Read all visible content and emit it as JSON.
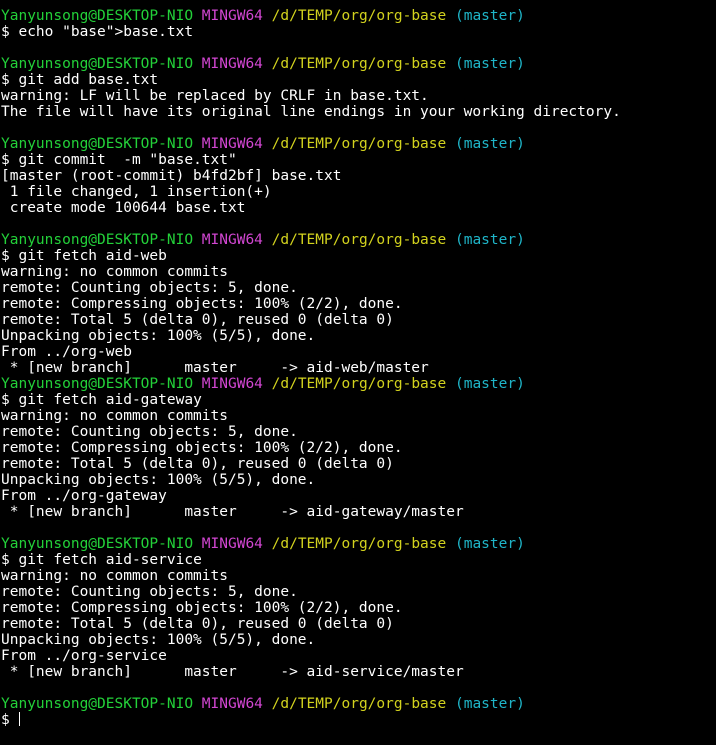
{
  "prompt": {
    "user": "Yanyunsong@DESKTOP-NIO",
    "system": "MINGW64",
    "path": "/d/TEMP/org/org-base",
    "branch": "(master)",
    "symbol": "$"
  },
  "colors": {
    "background": "#000000",
    "text": "#ffffff",
    "user": "#23d139",
    "system": "#d146d1",
    "path": "#d2d21e",
    "branch": "#1fb5c8"
  },
  "blocks": [
    {
      "command": "echo \"base\">base.txt",
      "output": []
    },
    {
      "command": "git add base.txt",
      "output": [
        "warning: LF will be replaced by CRLF in base.txt.",
        "The file will have its original line endings in your working directory."
      ]
    },
    {
      "command": "git commit  -m \"base.txt\"",
      "output": [
        "[master (root-commit) b4fd2bf] base.txt",
        " 1 file changed, 1 insertion(+)",
        " create mode 100644 base.txt"
      ]
    },
    {
      "command": "git fetch aid-web",
      "output": [
        "warning: no common commits",
        "remote: Counting objects: 5, done.",
        "remote: Compressing objects: 100% (2/2), done.",
        "remote: Total 5 (delta 0), reused 0 (delta 0)",
        "Unpacking objects: 100% (5/5), done.",
        "From ../org-web",
        " * [new branch]      master     -> aid-web/master"
      ]
    },
    {
      "command": "git fetch aid-gateway",
      "output": [
        "warning: no common commits",
        "remote: Counting objects: 5, done.",
        "remote: Compressing objects: 100% (2/2), done.",
        "remote: Total 5 (delta 0), reused 0 (delta 0)",
        "Unpacking objects: 100% (5/5), done.",
        "From ../org-gateway",
        " * [new branch]      master     -> aid-gateway/master"
      ]
    },
    {
      "command": "git fetch aid-service",
      "output": [
        "warning: no common commits",
        "remote: Counting objects: 5, done.",
        "remote: Compressing objects: 100% (2/2), done.",
        "remote: Total 5 (delta 0), reused 0 (delta 0)",
        "Unpacking objects: 100% (5/5), done.",
        "From ../org-service",
        " * [new branch]      master     -> aid-service/master"
      ]
    },
    {
      "command": "",
      "output": [],
      "active": true
    }
  ]
}
